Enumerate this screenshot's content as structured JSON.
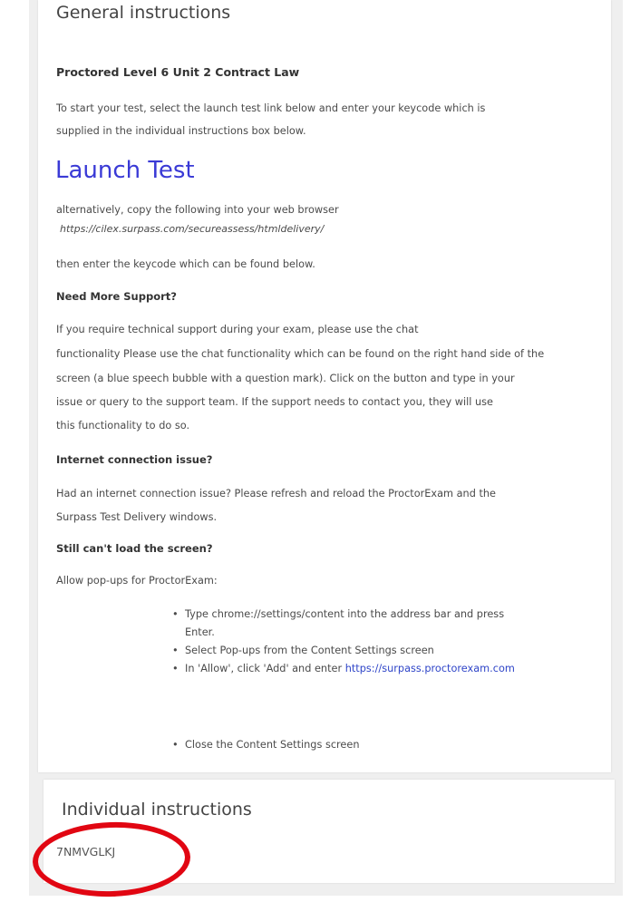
{
  "general": {
    "heading": "General instructions",
    "exam_title": "Proctored Level 6 Unit 2 Contract Law",
    "intro_line1": "To start your test, select the launch test link below and enter your keycode which is",
    "intro_line2": "supplied in the individual instructions box below.",
    "launch_link": "Launch Test",
    "alt_line": "alternatively, copy the following into your web browser",
    "alt_url": "https://cilex.surpass.com/secureassess/htmldelivery/",
    "then_line": "then enter the keycode which can be found below.",
    "support_heading": "Need More Support?",
    "support_lines": [
      "If you require technical support during your exam, please use the chat",
      "functionality Please use the chat functionality which can be found on the right hand side of the",
      "screen (a blue speech bubble with a question mark). Click on the button and type in your",
      "issue or query to the support team. If the support needs to contact you, they will use",
      "this functionality to do so."
    ],
    "internet_heading": "Internet connection issue?",
    "internet_lines": [
      "Had an internet connection issue? Please refresh and reload the ProctorExam and the",
      "Surpass Test Delivery windows."
    ],
    "load_heading": "Still can't load the screen?",
    "popups_line": "Allow pop-ups for ProctorExam:",
    "bullet1_line1": "Type chrome://settings/content into the address bar and press",
    "bullet1_line2": "Enter.",
    "bullet2": "Select Pop-ups from the Content Settings screen",
    "bullet3_prefix": "In 'Allow', click 'Add' and enter ",
    "bullet3_link": "https://surpass.proctorexam.com",
    "bullet4": "Close the Content Settings screen"
  },
  "individual": {
    "heading": "Individual instructions",
    "keycode": "7NMVGLKJ"
  },
  "annotation": {
    "circle_color": "#e10612"
  }
}
